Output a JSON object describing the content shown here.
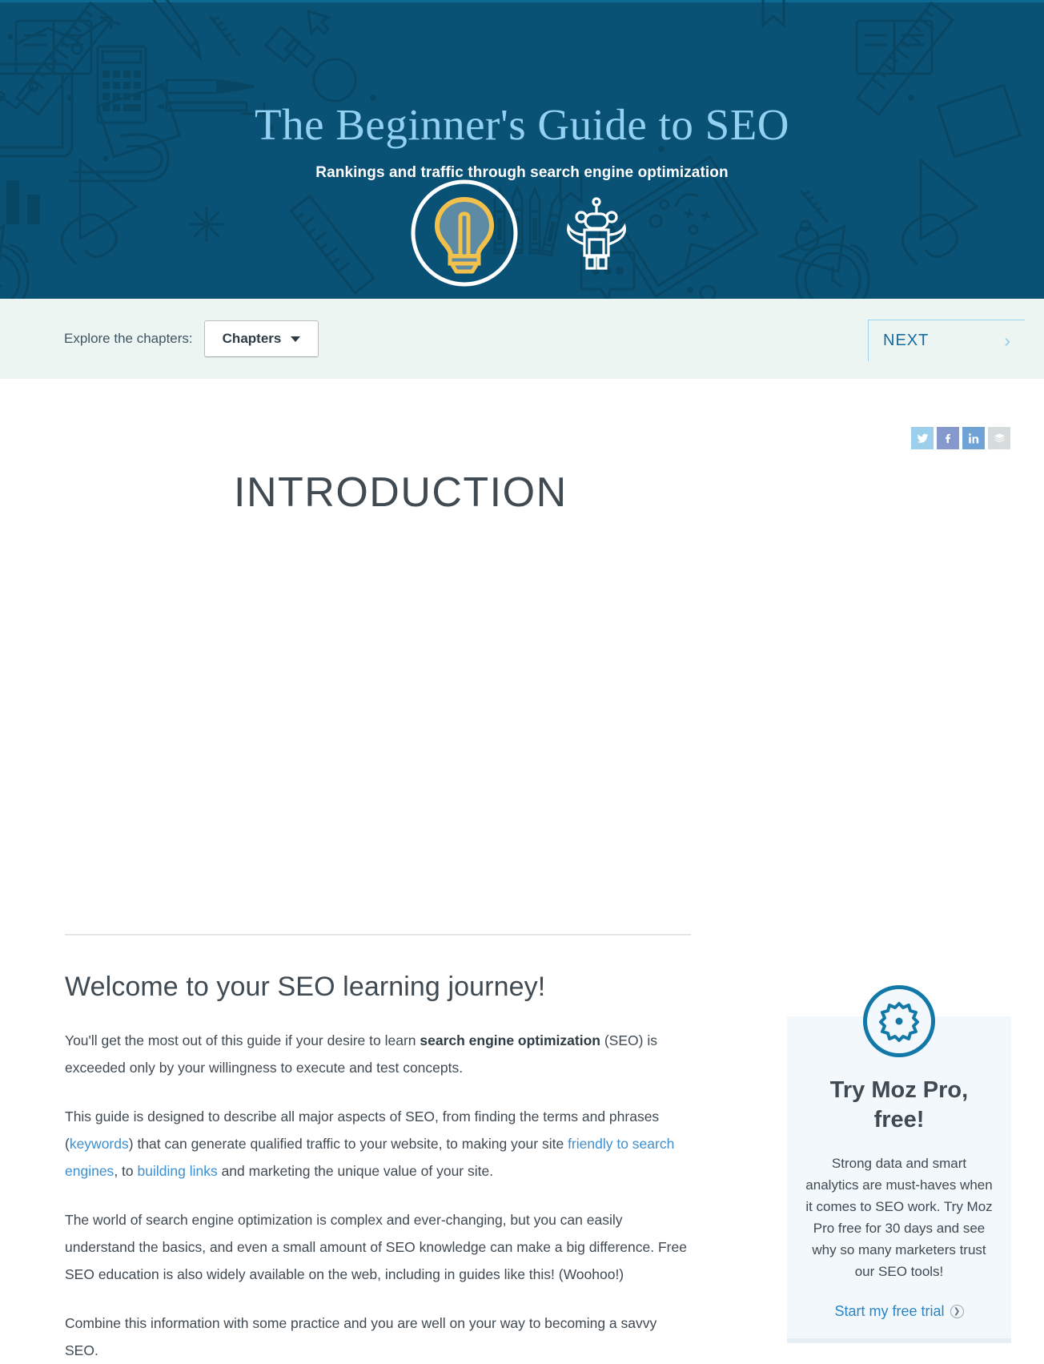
{
  "hero": {
    "title": "The Beginner's Guide to SEO",
    "subtitle": "Rankings and traffic through search engine optimization",
    "background_color": "#0a5176",
    "title_color": "#93d1f2",
    "icons": [
      "lightbulb-icon",
      "robot-icon"
    ]
  },
  "navbar": {
    "explore_label": "Explore the chapters:",
    "chapters_button": "Chapters",
    "next_label": "NEXT",
    "next_icon": "chevron-right-icon",
    "background_color": "#edf5f3"
  },
  "share": {
    "items": [
      {
        "name": "twitter",
        "glyph": "twitter-icon",
        "color": "#9ccfec"
      },
      {
        "name": "facebook",
        "glyph": "facebook-icon",
        "color": "#8599cc"
      },
      {
        "name": "linkedin",
        "glyph": "linkedin-icon",
        "color": "#6fa3d6"
      },
      {
        "name": "buffer",
        "glyph": "buffer-icon",
        "color": "#d6dcdc"
      }
    ]
  },
  "main": {
    "page_title": "INTRODUCTION",
    "heading": "Welcome to your SEO learning journey!",
    "paragraphs": {
      "p1_a": "You'll get the most out of this guide if your desire to learn ",
      "p1_strong": "search engine optimization",
      "p1_b": " (SEO) is exceeded only by your willingness to execute and test concepts.",
      "p2_a": "This guide is designed to describe all major aspects of SEO, from finding the terms and phrases (",
      "p2_link1": "keywords",
      "p2_b": ") that can generate qualified traffic to your website, to making your site ",
      "p2_link2": "friendly to search engines",
      "p2_c": ", to ",
      "p2_link3": "building links",
      "p2_d": " and marketing the unique value of your site.",
      "p3": "The world of search engine optimization is complex and ever-changing, but you can easily understand the basics, and even a small amount of SEO knowledge can make a big difference. Free SEO education is also widely available on the web, including in guides like this! (Woohoo!)",
      "p4": "Combine this information with some practice and you are well on your way to becoming a savvy SEO."
    },
    "link_color": "#3e8fd0"
  },
  "promo": {
    "icon": "gear-icon",
    "title": "Try Moz Pro, free!",
    "body": "Strong data and smart analytics are must-haves when it comes to SEO work. Try Moz Pro free for 30 days and see why so many marketers trust our SEO tools!",
    "cta": "Start my free trial",
    "cta_icon": "circle-chevron-right-icon",
    "accent_color": "#1278a8",
    "background_color": "#f2f8fc"
  }
}
